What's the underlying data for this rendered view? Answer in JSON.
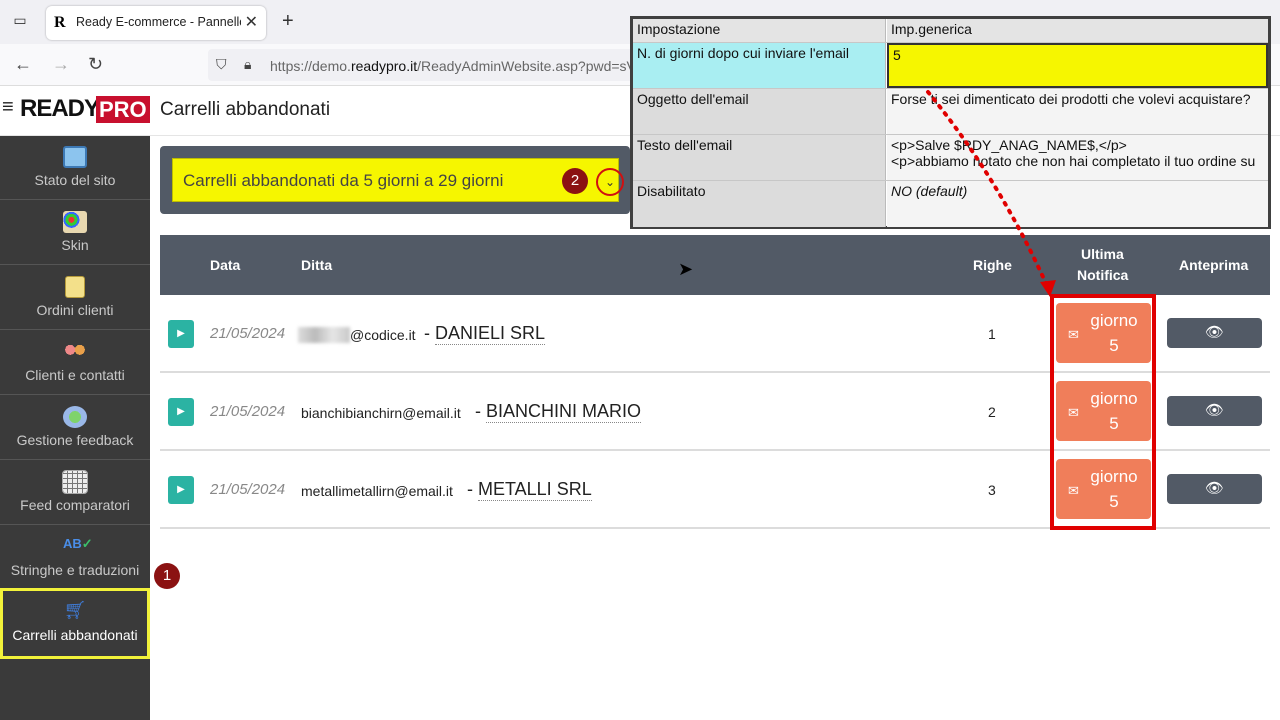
{
  "browser": {
    "tab_title": "Ready E-commerce - Pannello",
    "url_prefix": "https://demo.",
    "url_domain": "readypro.it",
    "url_rest": "/ReadyAdminWebsite.asp?pwd=sV"
  },
  "header": {
    "logo_ready": "READY",
    "logo_pro": "PRO",
    "page_title": "Carrelli abbandonati"
  },
  "sidebar": {
    "items": [
      {
        "label": "Stato del sito",
        "icon": "monitor-icon"
      },
      {
        "label": "Skin",
        "icon": "palette-icon"
      },
      {
        "label": "Ordini clienti",
        "icon": "document-icon"
      },
      {
        "label": "Clienti e contatti",
        "icon": "users-icon"
      },
      {
        "label": "Gestione feedback",
        "icon": "chat-icon"
      },
      {
        "label": "Feed comparatori",
        "icon": "grid-icon"
      },
      {
        "label": "Stringhe e traduzioni",
        "icon": "ab-check-icon"
      },
      {
        "label": "Carrelli abbandonati",
        "icon": "cart-icon"
      }
    ]
  },
  "markers": {
    "one": "1",
    "two": "2"
  },
  "filter": {
    "value": "Carrelli abbandonati da 5 giorni a 29 giorni"
  },
  "table": {
    "columns": {
      "data": "Data",
      "ditta": "Ditta",
      "righe": "Righe",
      "ultima_l1": "Ultima",
      "ultima_l2": "Notifica",
      "anteprima": "Anteprima"
    },
    "rows": [
      {
        "date": "21/05/2024",
        "email": "@codice.it",
        "company": "DANIELI SRL",
        "righe": "1",
        "notifica_l1": "giorno",
        "notifica_l2": "5"
      },
      {
        "date": "21/05/2024",
        "email": "bianchibianchirn@email.it",
        "company": "BIANCHINI MARIO",
        "righe": "2",
        "notifica_l1": "giorno",
        "notifica_l2": "5"
      },
      {
        "date": "21/05/2024",
        "email": "metallimetallirn@email.it",
        "company": "METALLI SRL",
        "righe": "3",
        "notifica_l1": "giorno",
        "notifica_l2": "5"
      }
    ]
  },
  "settings": {
    "header_key": "Impostazione",
    "header_val": "Imp.generica",
    "rows": [
      {
        "key": "N. di giorni dopo cui inviare l'email",
        "value": "5"
      },
      {
        "key": "Oggetto dell'email",
        "value": "Forse ti sei dimenticato dei prodotti che volevi acquistare?"
      },
      {
        "key": "Testo dell'email",
        "value_l1": "<p>Salve $RDY_ANAG_NAME$,</p>",
        "value_l2": "<p>abbiamo notato che non hai completato il tuo ordine su"
      },
      {
        "key": "Disabilitato",
        "value": "NO (default)"
      }
    ]
  },
  "colors": {
    "accent_teal": "#2bb3a3",
    "badge_orange": "#f07e5a",
    "sidebar_bg": "#3a3a3a",
    "highlight_yellow": "#f6f600",
    "annotation_red": "#e00000"
  }
}
